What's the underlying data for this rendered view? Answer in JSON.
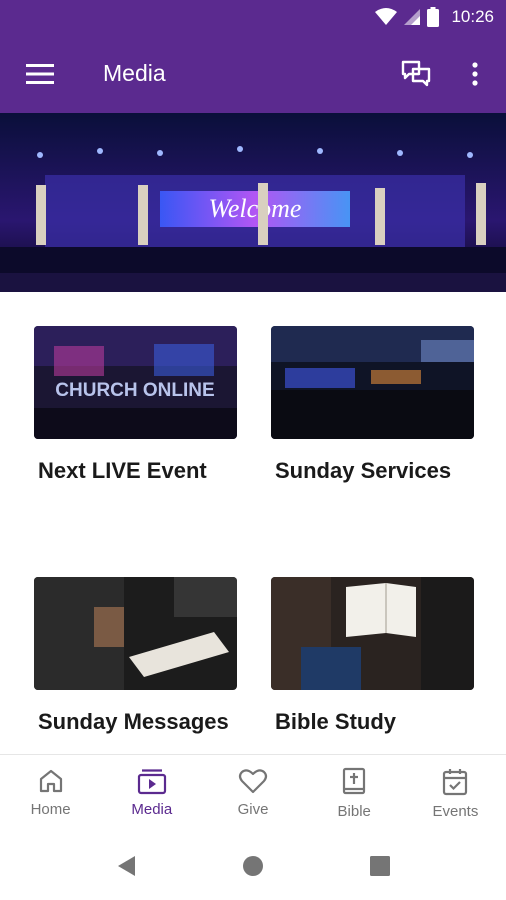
{
  "status_bar": {
    "time": "10:26"
  },
  "app_bar": {
    "title": "Media"
  },
  "cards": [
    {
      "label": "Next LIVE Event",
      "thumb_text": "CHURCH ONLINE"
    },
    {
      "label": "Sunday Services"
    },
    {
      "label": "Sunday Messages"
    },
    {
      "label": "Bible Study"
    }
  ],
  "hero": {
    "screen_text": "Welcome"
  },
  "bottom_nav": {
    "items": [
      {
        "label": "Home",
        "icon": "home-icon"
      },
      {
        "label": "Media",
        "icon": "media-icon",
        "active": true
      },
      {
        "label": "Give",
        "icon": "heart-icon"
      },
      {
        "label": "Bible",
        "icon": "bible-icon"
      },
      {
        "label": "Events",
        "icon": "calendar-check-icon"
      }
    ]
  },
  "colors": {
    "primary": "#5b2a8f",
    "nav_inactive": "#757575"
  }
}
